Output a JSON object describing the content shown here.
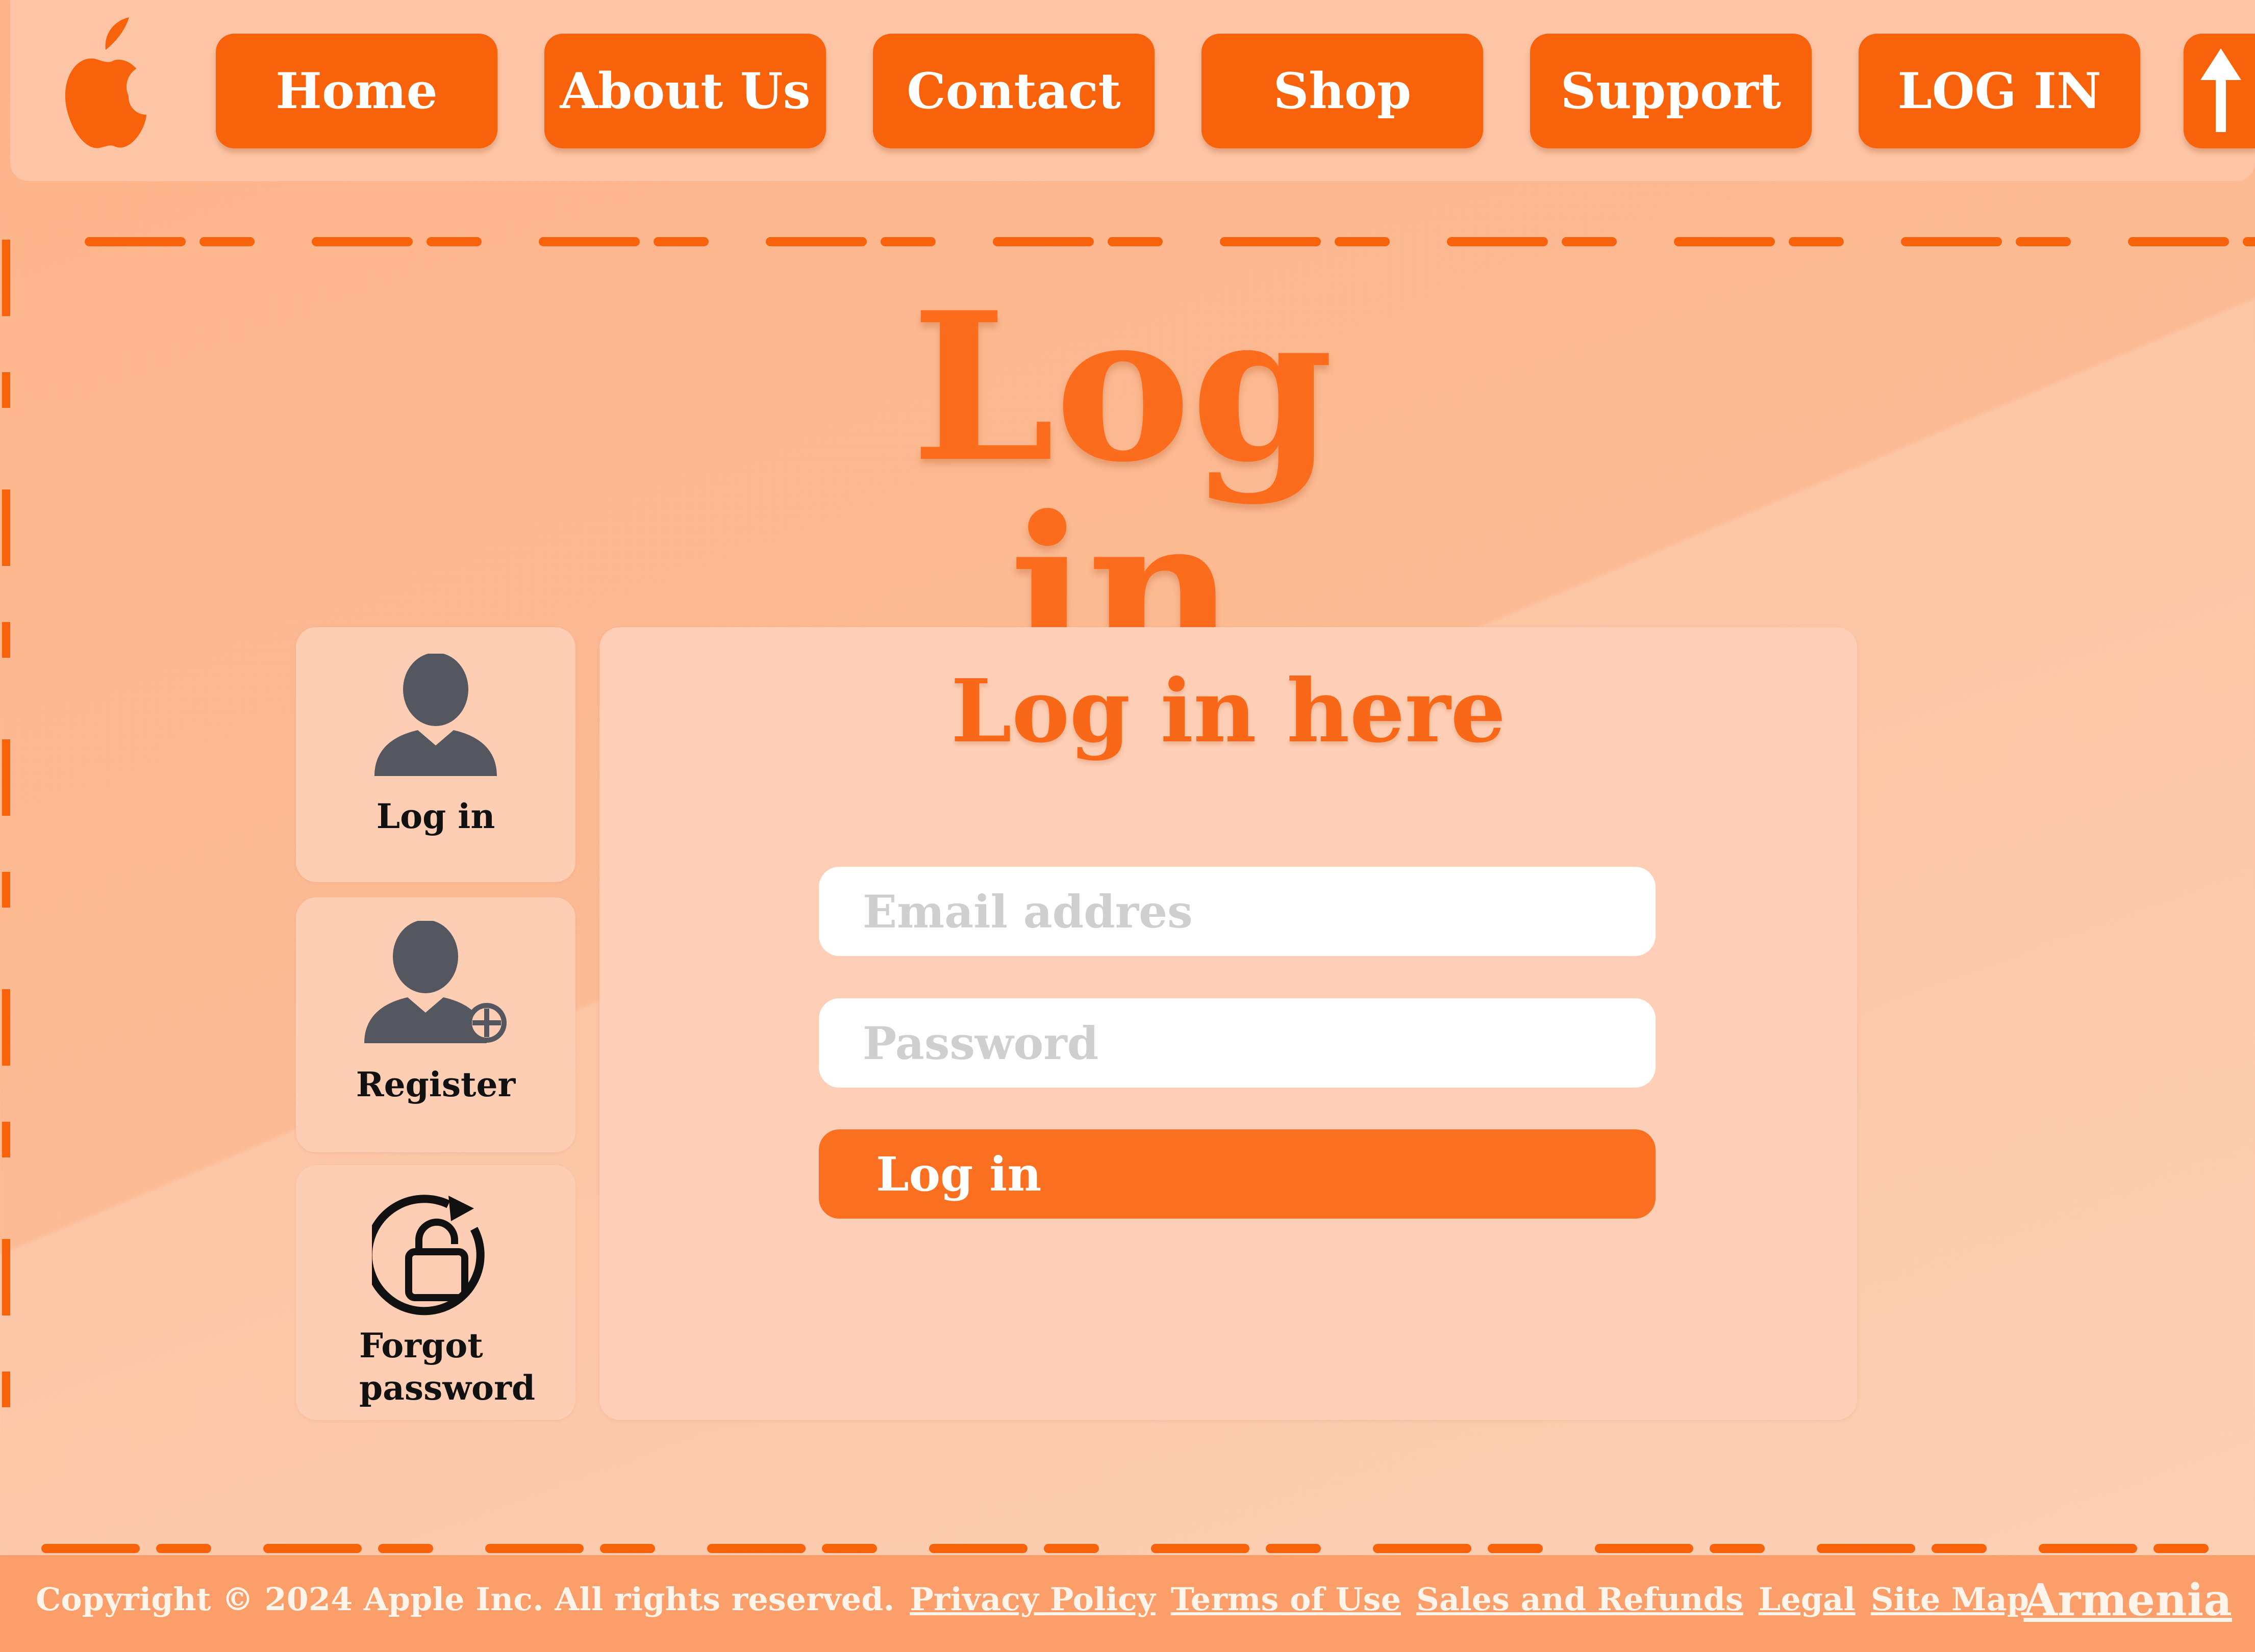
{
  "nav": {
    "items": [
      {
        "label": "Home"
      },
      {
        "label": "About Us"
      },
      {
        "label": "Contact"
      },
      {
        "label": "Shop"
      },
      {
        "label": "Support"
      },
      {
        "label": "LOG IN"
      }
    ],
    "logo_icon": "bitten-apple-icon",
    "scroll_top_icon": "arrow-up-icon"
  },
  "page": {
    "title": "Log in"
  },
  "side_menu": [
    {
      "label": "Log in",
      "icon": "user-icon"
    },
    {
      "label": "Register",
      "icon": "user-add-icon"
    },
    {
      "label": "Forgot password",
      "icon": "lock-reset-icon"
    }
  ],
  "form": {
    "title": "Log in here",
    "email_placeholder": "Email addres",
    "password_placeholder": "Password",
    "submit_label": "Log in"
  },
  "footer": {
    "copyright": "Copyright © 2024 Apple Inc. All rights reserved.",
    "links": [
      "Privacy Policy",
      "Terms of Use",
      "Sales and Refunds",
      "Legal",
      "Site Map"
    ],
    "country": "Armenia"
  },
  "colors": {
    "accent": "#f7620b",
    "background": "#fdb48a",
    "panel": "#fecfb6",
    "text_dark": "#111111"
  }
}
